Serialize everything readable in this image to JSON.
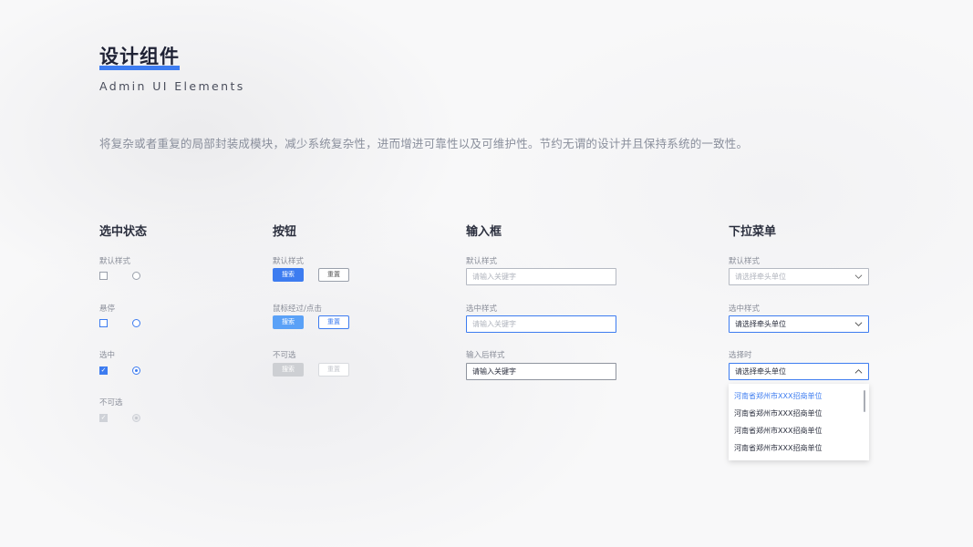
{
  "header": {
    "title": "设计组件",
    "subtitle": "Admin UI Elements",
    "description": "将复杂或者重复的局部封装成模块，减少系统复杂性，进而增进可靠性以及可维护性。节约无谓的设计并且保持系统的一致性。",
    "accent_color": "#3d7cf0"
  },
  "selection": {
    "heading": "选中状态",
    "default_label": "默认样式",
    "hover_label": "悬停",
    "checked_label": "选中",
    "disabled_label": "不可选"
  },
  "buttons": {
    "heading": "按钮",
    "default_label": "默认样式",
    "hover_label": "鼠标经过/点击",
    "disabled_label": "不可选",
    "primary_text": "搜索",
    "secondary_text": "重置"
  },
  "inputs": {
    "heading": "输入框",
    "default_label": "默认样式",
    "focus_label": "选中样式",
    "filled_label": "输入后样式",
    "placeholder": "请输入关键字",
    "filled_value": "请输入关键字"
  },
  "selects": {
    "heading": "下拉菜单",
    "default_label": "默认样式",
    "focus_label": "选中样式",
    "open_label": "选择时",
    "placeholder": "请选择牵头单位",
    "selected_value": "请选择牵头单位",
    "options": [
      "河南省郑州市XXX招商单位",
      "河南省郑州市XXX招商单位",
      "河南省郑州市XXX招商单位",
      "河南省郑州市XXX招商单位"
    ]
  }
}
